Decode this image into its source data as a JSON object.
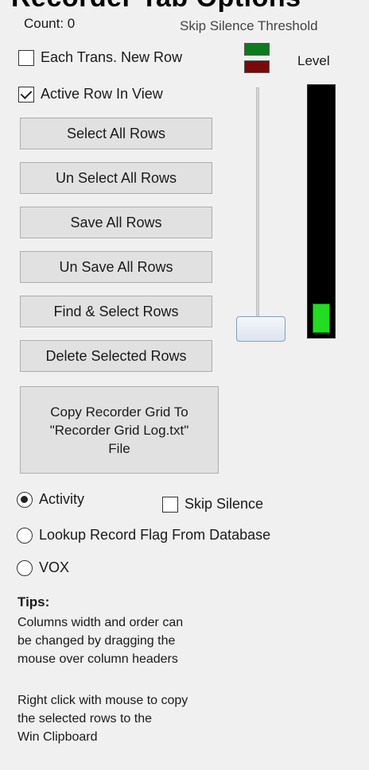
{
  "title": "Recorder Tab Options",
  "count_label": "Count: 0",
  "threshold_label": "Skip Silence Threshold",
  "level_label": "Level",
  "checkboxes": {
    "each_trans_new_row": {
      "label": "Each Trans. New Row",
      "checked": false
    },
    "active_row_in_view": {
      "label": "Active Row In View",
      "checked": true
    },
    "skip_silence": {
      "label": "Skip Silence",
      "checked": false
    }
  },
  "buttons": {
    "select_all": "Select All Rows",
    "unselect_all": "Un Select All Rows",
    "save_all": "Save All Rows",
    "unsave_all": "Un Save All Rows",
    "find_select": "Find & Select Rows",
    "delete_selected": "Delete Selected Rows",
    "copy_grid": {
      "line1": "Copy Recorder Grid To",
      "line2": "\"Recorder Grid Log.txt\"",
      "line3": "File"
    }
  },
  "indicators": {
    "top_color": "#0d7a1e",
    "bottom_color": "#7a0a0a"
  },
  "threshold_slider": {
    "value_fraction": 0.05
  },
  "level_meter": {
    "fill_fraction": 0.12,
    "color": "#22dd22"
  },
  "radios": {
    "activity": {
      "label": "Activity",
      "selected": true
    },
    "lookup": {
      "label": "Lookup Record Flag From Database",
      "selected": false
    },
    "vox": {
      "label": "VOX",
      "selected": false
    }
  },
  "tips": {
    "title": "Tips:",
    "para1": [
      "Columns width and order can",
      "be changed by dragging the",
      "mouse over column headers"
    ],
    "para2": [
      "Right click with mouse to copy",
      "the selected rows to the",
      "Win Clipboard"
    ]
  }
}
